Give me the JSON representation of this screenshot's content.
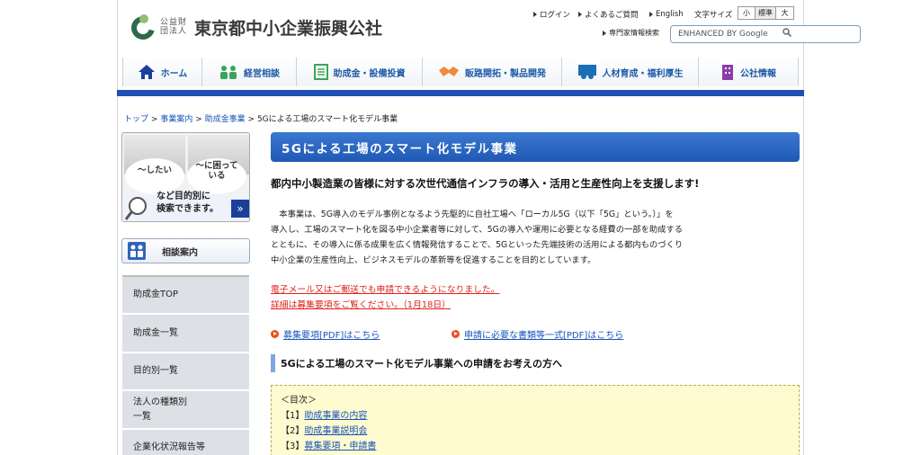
{
  "header": {
    "logo_sub": "公益財団法人",
    "logo_name": "東京都中小企業振興公社",
    "util_links": [
      "ログイン",
      "よくあるご質問",
      "English"
    ],
    "font_size_label": "文字サイズ",
    "font_sizes": [
      "小",
      "標準",
      "大"
    ],
    "pro_search_label": "専門家情報検索",
    "search_placeholder": "ENHANCED BY Google"
  },
  "nav": {
    "items": [
      {
        "label": "ホーム",
        "icon": "home-icon"
      },
      {
        "label": "経営相談",
        "icon": "people-icon"
      },
      {
        "label": "助成金・設備投資",
        "icon": "document-icon"
      },
      {
        "label": "販路開拓・製品開発",
        "icon": "handshake-icon"
      },
      {
        "label": "人材育成・福利厚生",
        "icon": "training-icon"
      },
      {
        "label": "公社情報",
        "icon": "building-icon"
      }
    ],
    "accent": "#1f4fb4"
  },
  "breadcrumb": {
    "items": [
      "トップ",
      "事業案内",
      "助成金事業"
    ],
    "current": "5Gによる工場のスマート化モデル事業",
    "sep": ">"
  },
  "sidebar": {
    "banner": {
      "bubble1": "～したい",
      "bubble2": "～に困って\nいる",
      "text": "など目的別に\n検索できます。",
      "arrow": "»"
    },
    "consult_label": "相談案内",
    "menu": [
      "助成金TOP",
      "助成金一覧",
      "目的別一覧",
      "法人の種類別\n一覧",
      "企業化状況報告等"
    ]
  },
  "main": {
    "title": "5Gによる工場のスマート化モデル事業",
    "lead": "都内中小製造業の皆様に対する次世代通信インフラの導入・活用と生産性向上を支援します!",
    "body": [
      "　本事業は、5G導入のモデル事例となるよう先駆的に自社工場へ「ローカル5G（以下「5G」という。）」を",
      "導入し、工場のスマート化を図る中小企業者等に対して、5Gの導入や運用に必要となる経費の一部を助成する",
      "とともに、その導入に係る成果を広く情報発信することで、5Gといった先端技術の活用による都内ものづくり",
      "中小企業の生産性向上、ビジネスモデルの革新等を促進することを目的としています。"
    ],
    "notice": [
      "電子メール又はご郵送でも申請できるようになりました。",
      "詳細は募集要項をご覧ください。（1月18日）"
    ],
    "links": [
      "募集要項[PDF]はこちら",
      "申請に必要な書類等一式[PDF]はこちら"
    ],
    "section_heading": "5Gによる工場のスマート化モデル事業への申請をお考えの方へ",
    "toc": {
      "title": "＜目次＞",
      "items": [
        {
          "num": "【1】",
          "label": "助成事業の内容"
        },
        {
          "num": "【2】",
          "label": "助成事業説明会"
        },
        {
          "num": "【3】",
          "label": "募集要項・申請書"
        }
      ]
    }
  }
}
